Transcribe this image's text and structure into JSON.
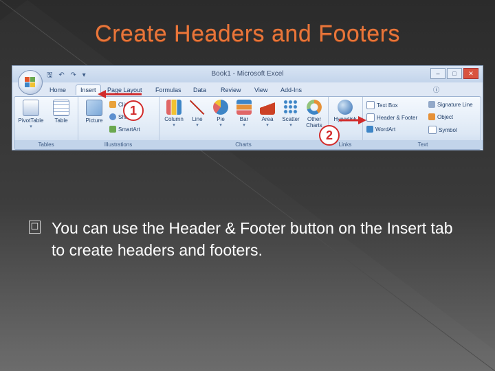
{
  "slide": {
    "title": "Create Headers and Footers",
    "bullet_text": "You can use the Header & Footer button on the Insert tab to create headers and footers.",
    "bullet_marker": "☐"
  },
  "excel": {
    "window_title": "Book1 - Microsoft Excel",
    "window_controls": [
      "–",
      "□",
      "✕"
    ],
    "tabs": [
      "Home",
      "Insert",
      "Page Layout",
      "Formulas",
      "Data",
      "Review",
      "View",
      "Add-Ins"
    ],
    "active_tab": "Insert",
    "groups": {
      "tables": {
        "label": "Tables",
        "buttons": [
          "PivotTable",
          "Table"
        ]
      },
      "illustrations": {
        "label": "Illustrations",
        "picture": "Picture",
        "small": [
          "Clip Art",
          "Shapes",
          "SmartArt"
        ]
      },
      "charts": {
        "label": "Charts",
        "buttons": [
          "Column",
          "Line",
          "Pie",
          "Bar",
          "Area",
          "Scatter",
          "Other Charts"
        ]
      },
      "links": {
        "label": "Links",
        "buttons": [
          "Hyperlink"
        ]
      },
      "text": {
        "label": "Text",
        "small_left": [
          "Text Box",
          "Header & Footer",
          "WordArt"
        ],
        "small_right": [
          "Signature Line",
          "Object",
          "Symbol"
        ]
      }
    },
    "callouts": [
      "1",
      "2"
    ]
  },
  "colors": {
    "title": "#e8753a",
    "callout_red": "#d22b2b",
    "ribbon_blue": "#dfe8f5"
  }
}
